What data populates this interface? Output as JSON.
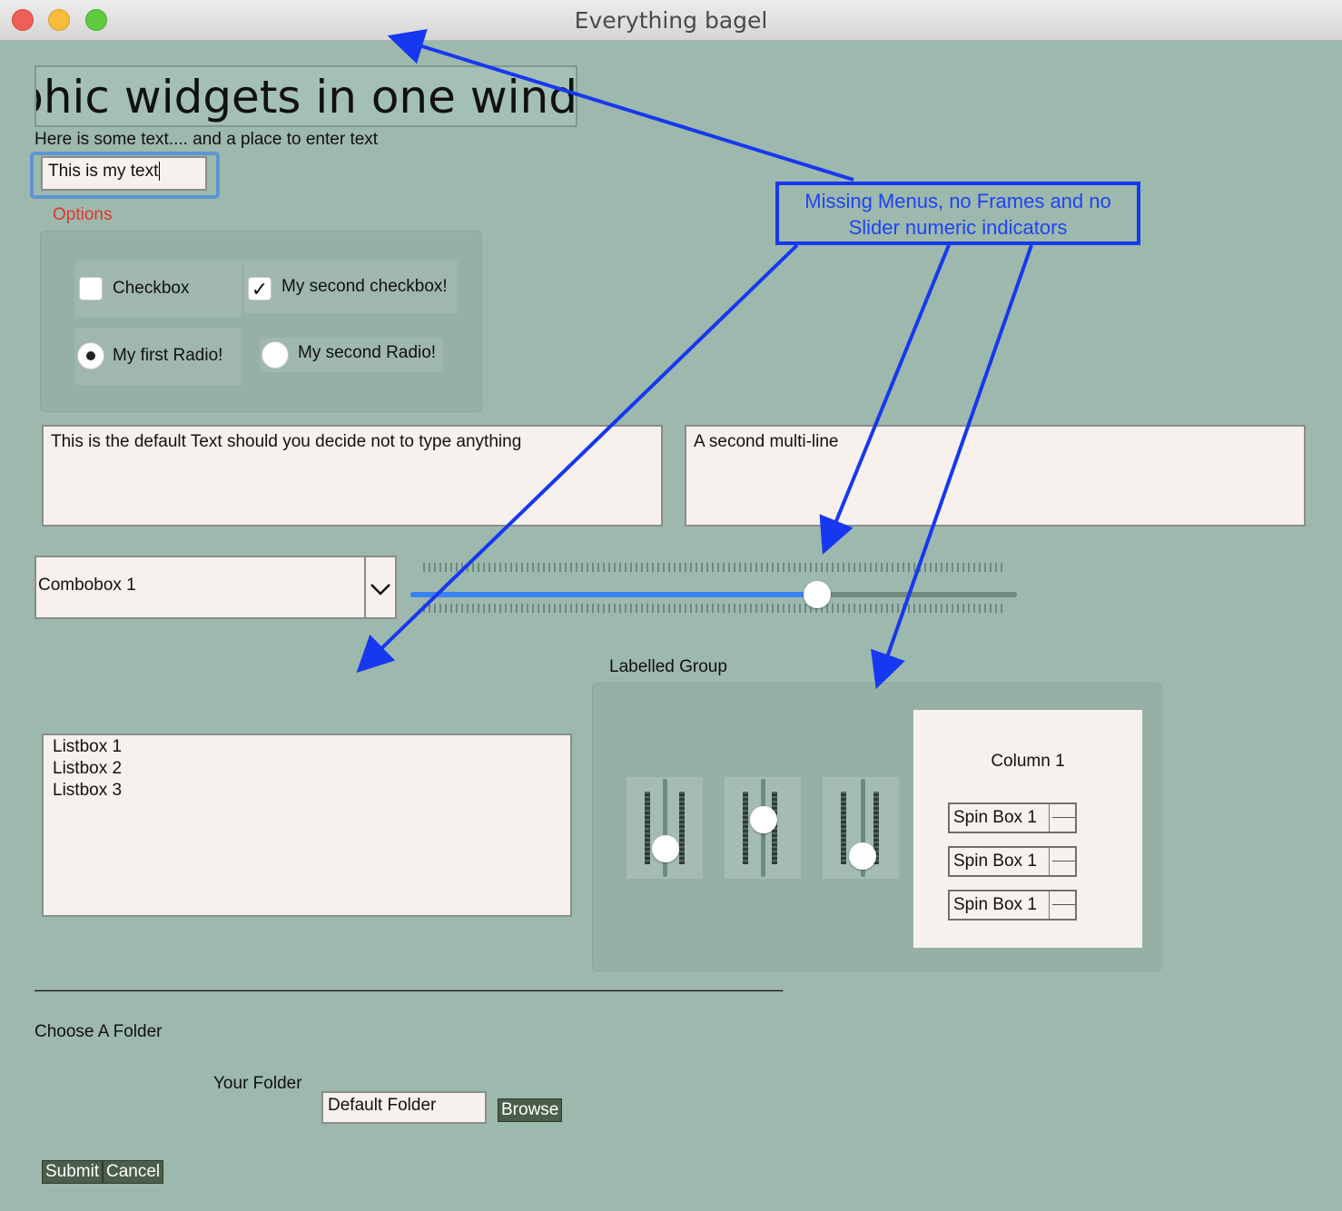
{
  "window": {
    "title": "Everything bagel"
  },
  "header": {
    "big_text": "graphic widgets in one wind",
    "intro_label": "Here is some text.... and a place to enter text",
    "text_input_value": "This is my text"
  },
  "options": {
    "title": "Options",
    "checkbox1_label": "Checkbox",
    "checkbox1_checked": false,
    "checkbox2_label": "My second checkbox!",
    "checkbox2_checked": true,
    "radio1_label": "My first Radio!",
    "radio1_selected": true,
    "radio2_label": "My second Radio!",
    "radio2_selected": false
  },
  "multiline": {
    "first": "This is the default Text should you decide not to type anything",
    "second": "A second multi-line"
  },
  "combo": {
    "value": "Combobox 1"
  },
  "slider": {
    "value_fraction": 0.67
  },
  "listbox": {
    "items": [
      "Listbox 1",
      "Listbox 2",
      "Listbox 3"
    ]
  },
  "group": {
    "title": "Labelled Group",
    "vsliders": [
      0.3,
      0.7,
      0.2
    ],
    "column_title": "Column 1",
    "spinboxes": [
      "Spin Box 1",
      "Spin Box 1",
      "Spin Box 1"
    ]
  },
  "separator": "______________________________________________________________________________",
  "folder": {
    "title": "Choose A Folder",
    "label": "Your Folder",
    "value": "Default Folder",
    "browse": "Browse"
  },
  "actions": {
    "submit": "Submit",
    "cancel": "Cancel"
  },
  "annotation": {
    "text": "Missing Menus, no Frames and no Slider numeric indicators",
    "color": "#1638f0"
  },
  "colors": {
    "window_bg": "#9db8ad",
    "accent": "#3b82f6",
    "options_title": "#e0362c"
  }
}
